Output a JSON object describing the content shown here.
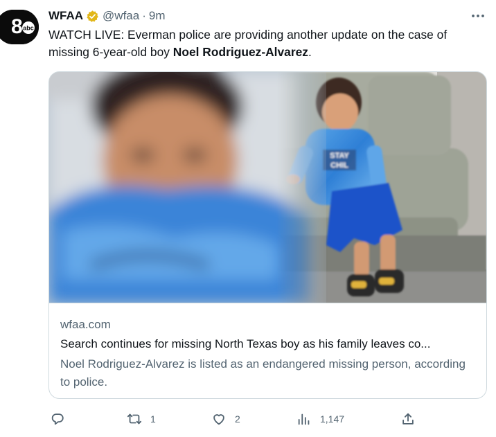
{
  "tweet": {
    "display_name": "WFAA",
    "handle": "@wfaa",
    "separator": "·",
    "time": "9m",
    "text_before": "WATCH LIVE: Everman police are providing another update on the case of missing 6-year-old boy ",
    "text_bold": "Noel Rodriguez-Alvarez",
    "text_after": "."
  },
  "card": {
    "domain": "wfaa.com",
    "title": "Search continues for missing North Texas boy as his family leaves co...",
    "description": "Noel Rodriguez-Alvarez is listed as an endangered missing person, according to police.",
    "shirt_text_line1": "STAY",
    "shirt_text_line2": "CHIL"
  },
  "avatar": {
    "logo_text": "abc",
    "digit": "8"
  },
  "actions": {
    "reply": {
      "icon": "reply-icon",
      "count": ""
    },
    "retweet": {
      "icon": "retweet-icon",
      "count": "1"
    },
    "like": {
      "icon": "like-icon",
      "count": "2"
    },
    "views": {
      "icon": "views-icon",
      "count": "1,147"
    },
    "share": {
      "icon": "share-icon",
      "count": ""
    }
  },
  "colors": {
    "text_primary": "#0f1419",
    "text_secondary": "#536471",
    "border": "#cfd9de",
    "verified_gold": "#e2b719"
  }
}
